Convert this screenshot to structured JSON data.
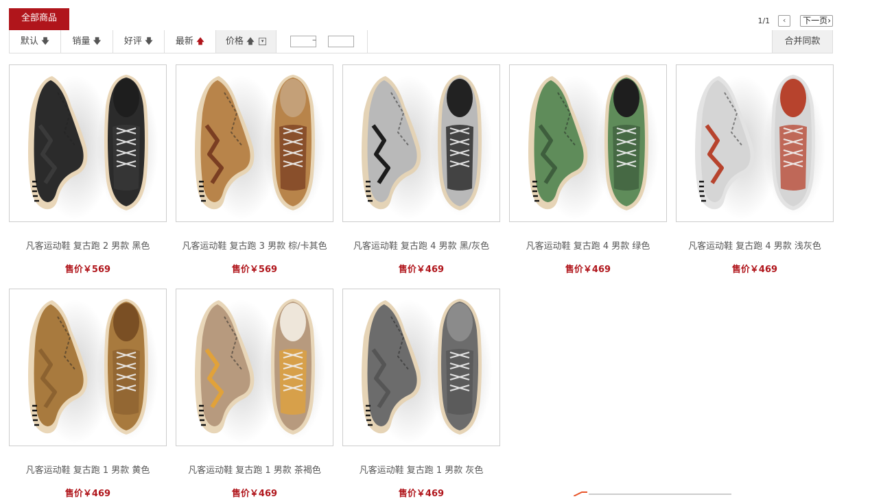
{
  "tabs": {
    "all_label": "全部商品"
  },
  "pager": {
    "count": "1/1",
    "prev": "‹",
    "next_label": "下一页",
    "next_arrow": "›"
  },
  "sort": {
    "items": [
      {
        "label": "默认",
        "arrow": "🡇"
      },
      {
        "label": "销量",
        "arrow": "🡇"
      },
      {
        "label": "好评",
        "arrow": "🡇"
      },
      {
        "label": "最新",
        "arrow": "🡅"
      },
      {
        "label": "价格",
        "arrow": "🡅"
      }
    ],
    "price_dash": "–",
    "price_min": "",
    "price_max": "",
    "merge_label": "合并同款"
  },
  "products": [
    {
      "name": "凡客运动鞋 复古跑 2 男款 黑色",
      "price": "售价￥569",
      "upper": "#2b2b2b",
      "accent": "#3a3a3a",
      "inside": "#1e1e1e",
      "sole": "#e9d6b8"
    },
    {
      "name": "凡客运动鞋 复古跑 3 男款 棕/卡其色",
      "price": "售价￥569",
      "upper": "#b8844a",
      "accent": "#7a3e22",
      "inside": "#c4a078",
      "sole": "#e7d4b4"
    },
    {
      "name": "凡客运动鞋 复古跑 4 男款 黑/灰色",
      "price": "售价￥469",
      "upper": "#b9b9b9",
      "accent": "#1c1c1c",
      "inside": "#222222",
      "sole": "#e4d3b6"
    },
    {
      "name": "凡客运动鞋 复古跑 4 男款 绿色",
      "price": "售价￥469",
      "upper": "#5f8c5a",
      "accent": "#3e5e3d",
      "inside": "#1e1e1e",
      "sole": "#e6d4b6"
    },
    {
      "name": "凡客运动鞋 复古跑 4 男款 浅灰色",
      "price": "售价￥469",
      "upper": "#d5d5d5",
      "accent": "#b7432d",
      "inside": "#b7432d",
      "sole": "#e3e3e3"
    },
    {
      "name": "凡客运动鞋 复古跑 1 男款 黄色",
      "price": "售价￥469",
      "upper": "#a87a3e",
      "accent": "#8c6230",
      "inside": "#7a4f24",
      "sole": "#ead7b8"
    },
    {
      "name": "凡客运动鞋 复古跑 1 男款 茶褐色",
      "price": "售价￥469",
      "upper": "#b79a7e",
      "accent": "#e1a23a",
      "inside": "#eee6da",
      "sole": "#e8d6b8"
    },
    {
      "name": "凡客运动鞋 复古跑 1 男款 灰色",
      "price": "售价￥469",
      "upper": "#6c6c6c",
      "accent": "#555555",
      "inside": "#8b8b8b",
      "sole": "#e6d4b6"
    }
  ]
}
